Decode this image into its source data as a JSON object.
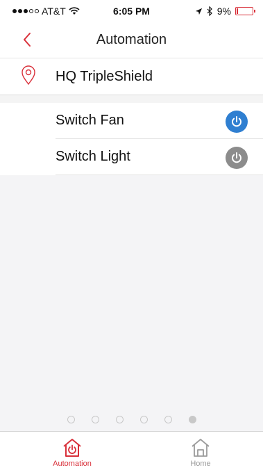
{
  "status_bar": {
    "carrier": "AT&T",
    "time": "6:05 PM",
    "battery": "9%",
    "battery_level": 0.09
  },
  "header": {
    "title": "Automation",
    "back_icon": "chevron-left-icon"
  },
  "location": {
    "name": "HQ TripleShield",
    "icon": "location-pin-icon"
  },
  "devices": [
    {
      "label": "Switch Fan",
      "state": "on",
      "button_color": "#2f7fd1"
    },
    {
      "label": "Switch Light",
      "state": "off",
      "button_color": "#8c8c8c"
    }
  ],
  "pagination": {
    "count": 6,
    "active_index": 5
  },
  "tabs": [
    {
      "label": "Automation",
      "icon": "automation-home-icon",
      "active": true
    },
    {
      "label": "Home",
      "icon": "home-icon",
      "active": false
    }
  ],
  "colors": {
    "accent": "#d9303a",
    "power_on": "#2f7fd1",
    "power_off": "#8c8c8c",
    "inactive_tab": "#9a9a9a"
  }
}
